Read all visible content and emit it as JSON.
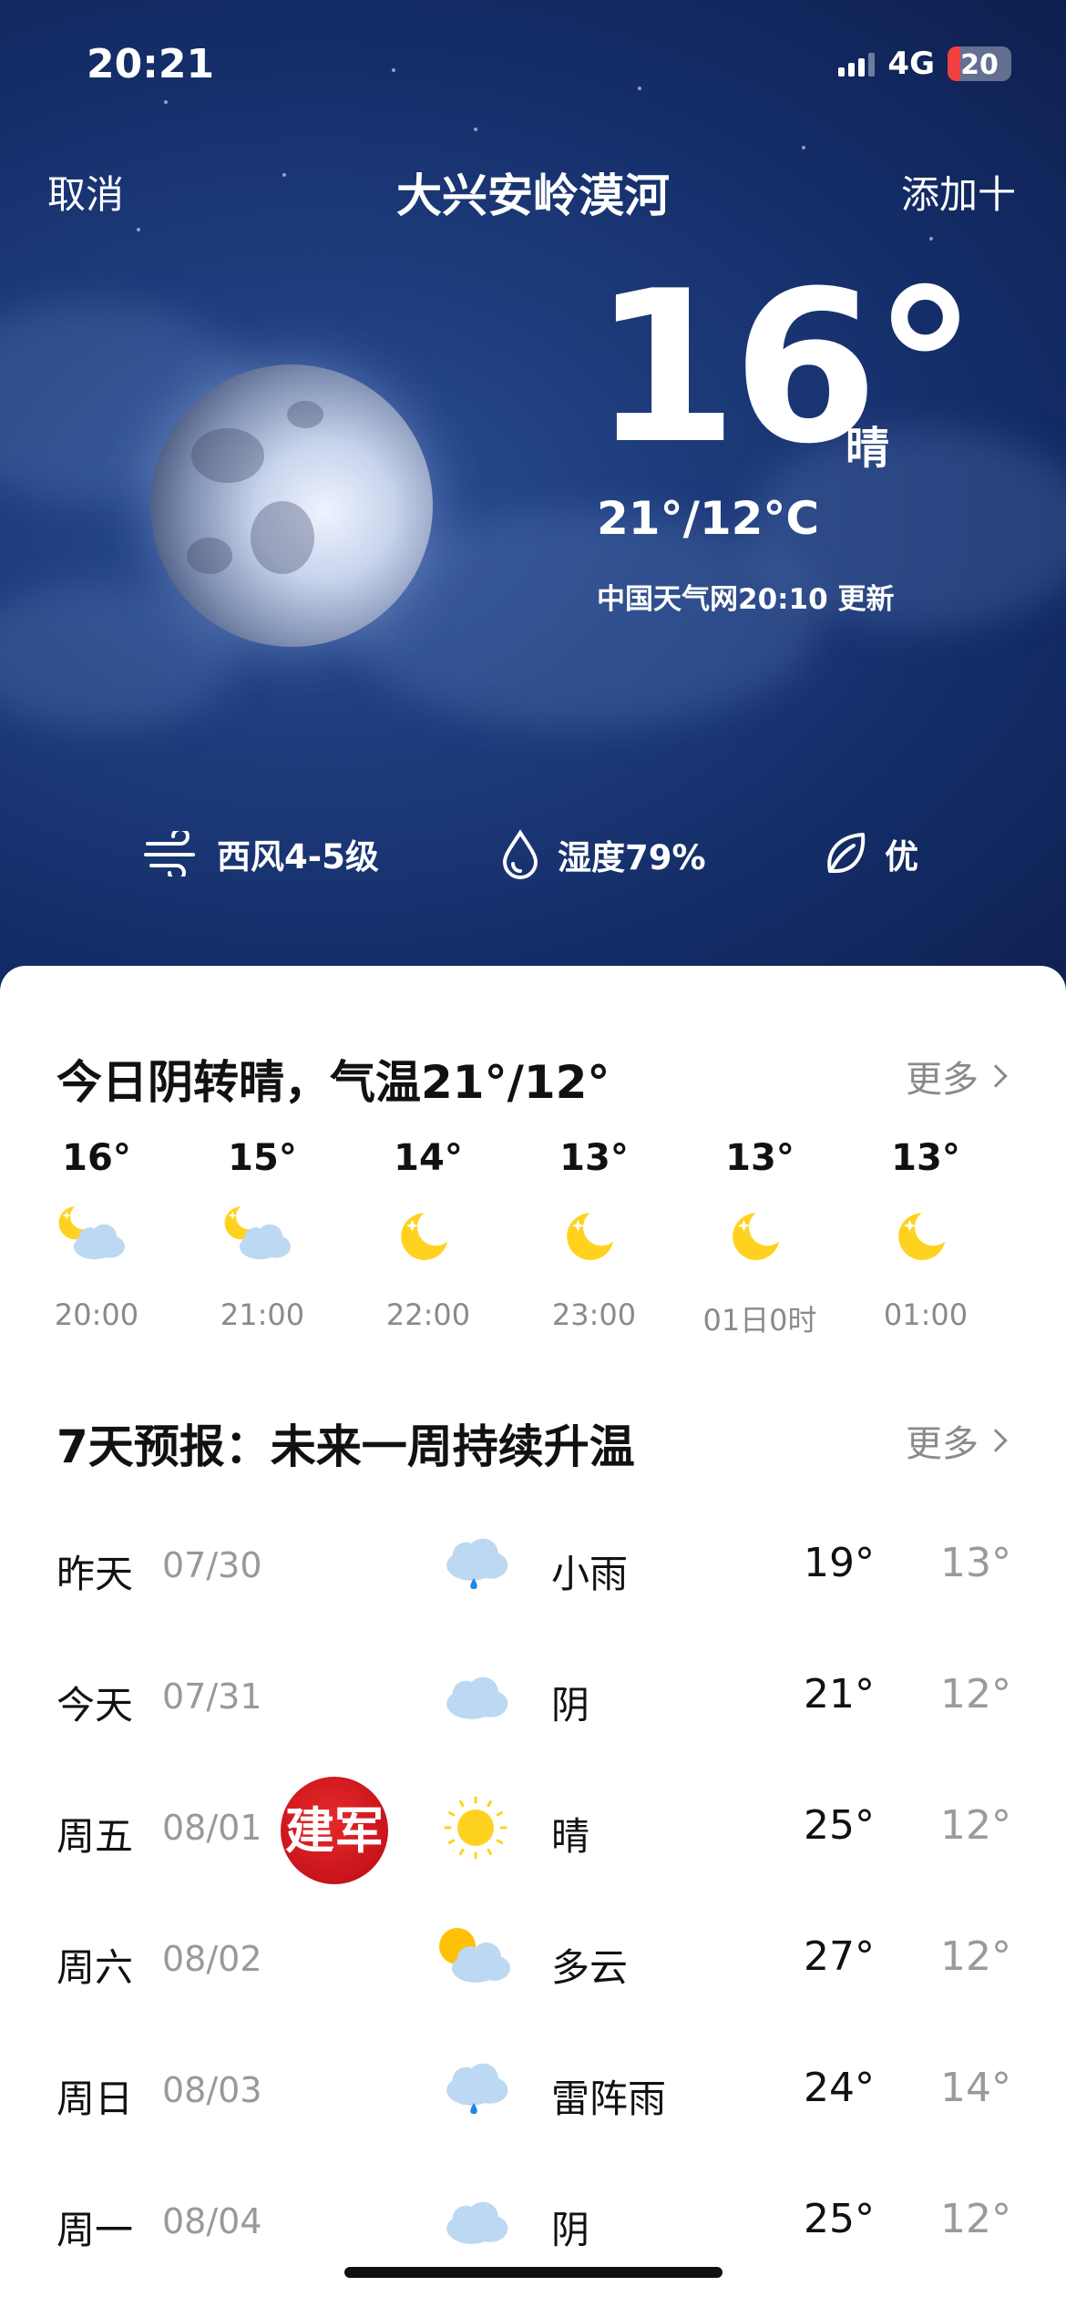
{
  "status_bar": {
    "time": "20:21",
    "network": "4G",
    "battery": "20",
    "battery_level": 0.2
  },
  "nav": {
    "cancel": "取消",
    "title": "大兴安岭漠河",
    "add": "添加十"
  },
  "current": {
    "temperature": "16°",
    "condition": "晴",
    "range": "21°/12°C",
    "update": "中国天气网20:10 更新",
    "metrics": {
      "wind": "西风4-5级",
      "humidity": "湿度79%",
      "air_quality": "优"
    }
  },
  "today": {
    "summary": "今日阴转晴，气温21°/12°",
    "more": "更多",
    "hours": [
      {
        "temp": "16°",
        "time": "20:00",
        "icon": "moon-cloud-icon"
      },
      {
        "temp": "15°",
        "time": "21:00",
        "icon": "moon-cloud-icon"
      },
      {
        "temp": "14°",
        "time": "22:00",
        "icon": "moon-icon"
      },
      {
        "temp": "13°",
        "time": "23:00",
        "icon": "moon-icon"
      },
      {
        "temp": "13°",
        "time": "01日0时",
        "icon": "moon-icon"
      },
      {
        "temp": "13°",
        "time": "01:00",
        "icon": "moon-icon"
      }
    ]
  },
  "forecast": {
    "title": "7天预报：未来一周持续升温",
    "more": "更多",
    "days": [
      {
        "day": "昨天",
        "date": "07/30",
        "icon": "rain-icon",
        "condition": "小雨",
        "high": "19°",
        "low": "13°"
      },
      {
        "day": "今天",
        "date": "07/31",
        "icon": "cloud-icon",
        "condition": "阴",
        "high": "21°",
        "low": "12°"
      },
      {
        "day": "周五",
        "date": "08/01",
        "icon": "sun-icon",
        "condition": "晴",
        "high": "25°",
        "low": "12°"
      },
      {
        "day": "周六",
        "date": "08/02",
        "icon": "partly-cloudy-icon",
        "condition": "多云",
        "high": "27°",
        "low": "12°"
      },
      {
        "day": "周日",
        "date": "08/03",
        "icon": "rain-icon",
        "condition": "雷阵雨",
        "high": "24°",
        "low": "14°"
      },
      {
        "day": "周一",
        "date": "08/04",
        "icon": "cloud-icon",
        "condition": "阴",
        "high": "25°",
        "low": "12°"
      }
    ]
  },
  "badge": {
    "text": "建军"
  },
  "colors": {
    "sky": "#142d68",
    "moon_yellow": "#ffd21f",
    "cloud_blue": "#bcd8f2",
    "rain_blue": "#1e88e5"
  }
}
